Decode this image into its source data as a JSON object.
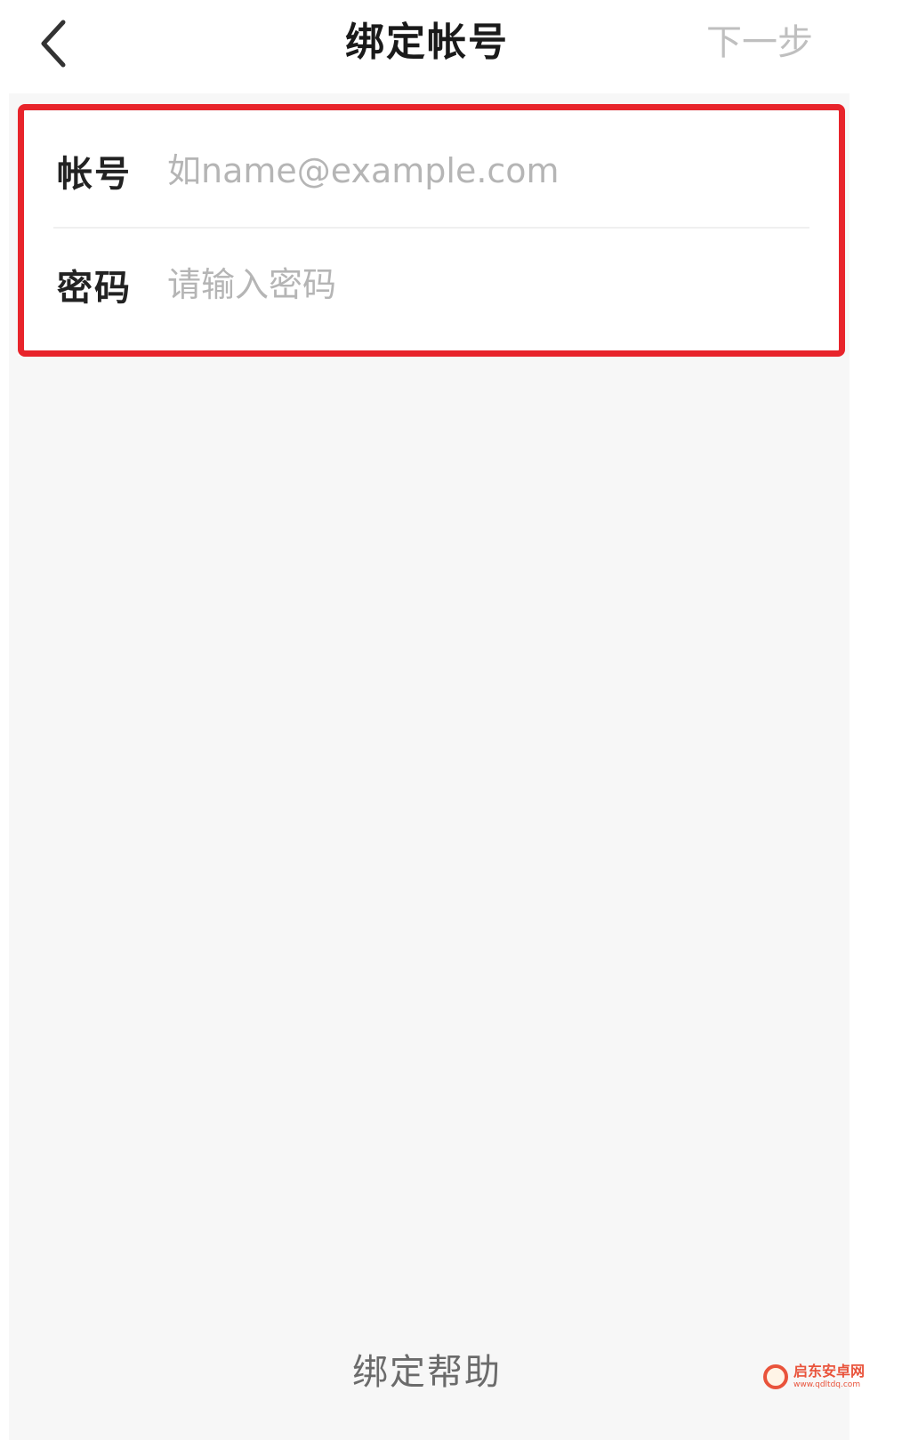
{
  "navbar": {
    "back_icon": "chevron-left-icon",
    "title": "绑定帐号",
    "next_label": "下一步"
  },
  "form": {
    "account_label": "帐号",
    "account_placeholder": "如name@example.com",
    "account_value": "",
    "password_label": "密码",
    "password_placeholder": "请输入密码",
    "password_value": ""
  },
  "footer": {
    "help_label": "绑定帮助"
  },
  "watermark": {
    "title": "启东安卓网",
    "url": "www.qdltdq.com"
  },
  "colors": {
    "highlight": "#e8242b",
    "background": "#f7f7f7",
    "disabled_text": "#bfbfbf"
  }
}
